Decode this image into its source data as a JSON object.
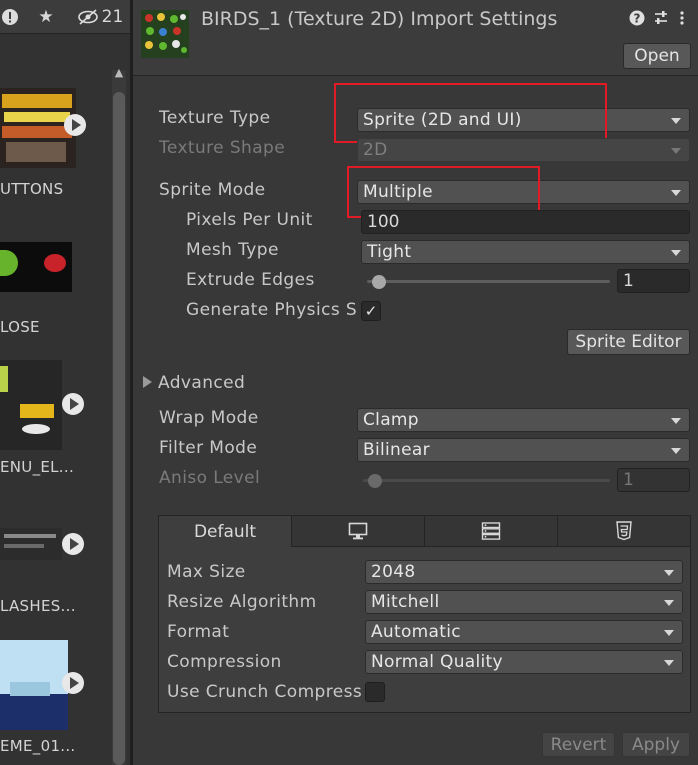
{
  "toolbar": {
    "alert_icon": "exclamation-icon",
    "star_icon": "star-icon",
    "hidden_icon": "eye-slash-icon",
    "hidden_count": "21"
  },
  "assets": [
    {
      "label": "UTTONS"
    },
    {
      "label": "LOSE"
    },
    {
      "label": "ENU_EL..."
    },
    {
      "label": "LASHES..."
    },
    {
      "label": "EME_01..."
    }
  ],
  "inspector": {
    "title": "BIRDS_1 (Texture 2D) Import Settings",
    "help_icon": "help-icon",
    "settings_icon": "sliders-icon",
    "menu_icon": "kebab-icon",
    "open_label": "Open",
    "texture_type_label": "Texture Type",
    "texture_type_value": "Sprite (2D and UI)",
    "texture_shape_label": "Texture Shape",
    "texture_shape_value": "2D",
    "sprite_mode_label": "Sprite Mode",
    "sprite_mode_value": "Multiple",
    "ppu_label": "Pixels Per Unit",
    "ppu_value": "100",
    "mesh_type_label": "Mesh Type",
    "mesh_type_value": "Tight",
    "extrude_label": "Extrude Edges",
    "extrude_value": "1",
    "extrude_level": 0.05,
    "physics_label": "Generate Physics S",
    "physics_check": "✓",
    "sprite_editor_label": "Sprite Editor",
    "advanced_label": "Advanced",
    "wrap_label": "Wrap Mode",
    "wrap_value": "Clamp",
    "filter_label": "Filter Mode",
    "filter_value": "Bilinear",
    "aniso_label": "Aniso Level",
    "aniso_value": "1",
    "aniso_level": 0.05
  },
  "platform": {
    "tabs": [
      {
        "label": "Default",
        "icon": null
      },
      {
        "label": "",
        "icon": "monitor-icon"
      },
      {
        "label": "",
        "icon": "server-icon"
      },
      {
        "label": "",
        "icon": "html5-icon"
      }
    ],
    "max_size_label": "Max Size",
    "max_size_value": "2048",
    "resize_label": "Resize Algorithm",
    "resize_value": "Mitchell",
    "format_label": "Format",
    "format_value": "Automatic",
    "compression_label": "Compression",
    "compression_value": "Normal Quality",
    "crunch_label": "Use Crunch Compress"
  },
  "footer": {
    "revert_label": "Revert",
    "apply_label": "Apply"
  },
  "colors": {
    "highlight": "#e01b24",
    "panel": "#383838"
  }
}
